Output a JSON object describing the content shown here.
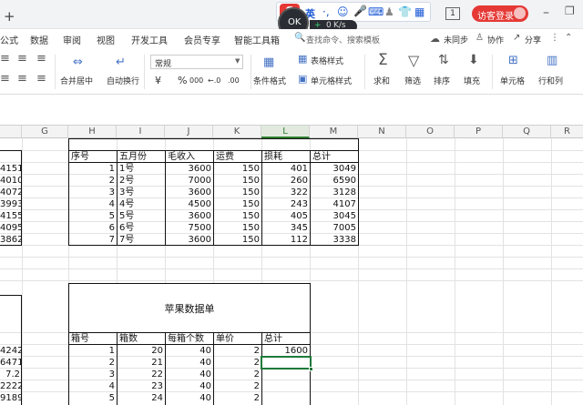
{
  "titlebar": {
    "new_tab": "+",
    "ime_lang": "英",
    "speed_value": "0",
    "speed_unit": "K/s",
    "sheet_count": "1",
    "login_label": "访客登录"
  },
  "menu": {
    "items": [
      "公式",
      "数据",
      "审阅",
      "视图",
      "开发工具",
      "会员专享",
      "智能工具箱"
    ],
    "search_placeholder": "查找命令、搜索模板",
    "unsync": "未同步",
    "collab": "协作",
    "share": "分享"
  },
  "ribbon": {
    "merge_center": "合并居中",
    "wrap_text": "自动换行",
    "number_format": "常规",
    "currency": "¥",
    "percent": "%",
    "thousands": "000",
    "inc_decimal": "←.0",
    "dec_decimal": ".00",
    "table_style": "表格样式",
    "cond_format": "条件格式",
    "cell_style": "单元格样式",
    "sum": "求和",
    "filter": "筛选",
    "sort": "排序",
    "fill": "填充",
    "cells": "单元格",
    "row_col": "行和列"
  },
  "columns": [
    "G",
    "H",
    "I",
    "J",
    "K",
    "L",
    "M",
    "N",
    "O",
    "P",
    "Q",
    "R"
  ],
  "left_clip": {
    "top": [
      "4151",
      "4010",
      "4072",
      "3993",
      "4155",
      "4095",
      "3862"
    ],
    "bottom": [
      "4242",
      "6471",
      "7.2",
      "2222",
      "9189"
    ]
  },
  "table1": {
    "headers": [
      "序号",
      "五月份",
      "毛收入",
      "运费",
      "损耗",
      "总计"
    ],
    "rows": [
      [
        "1",
        "1号",
        "3600",
        "150",
        "401",
        "3049"
      ],
      [
        "2",
        "2号",
        "7000",
        "150",
        "260",
        "6590"
      ],
      [
        "3",
        "3号",
        "3600",
        "150",
        "322",
        "3128"
      ],
      [
        "4",
        "4号",
        "4500",
        "150",
        "243",
        "4107"
      ],
      [
        "5",
        "5号",
        "3600",
        "150",
        "405",
        "3045"
      ],
      [
        "6",
        "6号",
        "7500",
        "150",
        "345",
        "7005"
      ],
      [
        "7",
        "7号",
        "3600",
        "150",
        "112",
        "3338"
      ]
    ]
  },
  "table2": {
    "title": "苹果数据单",
    "headers": [
      "箱号",
      "箱数",
      "每箱个数",
      "单价",
      "总计"
    ],
    "rows": [
      [
        "1",
        "20",
        "40",
        "2",
        "1600"
      ],
      [
        "2",
        "21",
        "40",
        "2",
        ""
      ],
      [
        "3",
        "22",
        "40",
        "2",
        ""
      ],
      [
        "4",
        "23",
        "40",
        "2",
        ""
      ],
      [
        "5",
        "24",
        "40",
        "2",
        ""
      ]
    ]
  }
}
